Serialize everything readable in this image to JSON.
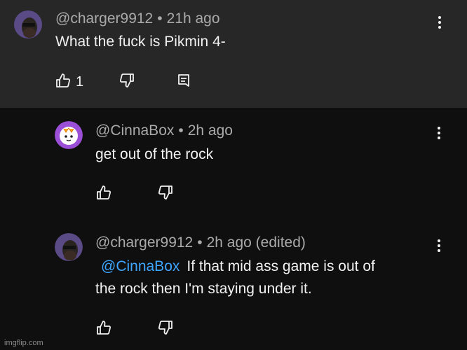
{
  "comments": [
    {
      "handle": "@charger9912",
      "time": "21h ago",
      "text": "What the fuck is Pikmin 4-",
      "like_count": "1"
    },
    {
      "handle": "@CinnaBox",
      "time": "2h ago",
      "text": "get out of the rock"
    },
    {
      "handle": "@charger9912",
      "time": "2h ago (edited)",
      "mention": "@CinnaBox",
      "text_line1": "If that mid ass game is out of",
      "text_line2": "the rock then I'm staying under it."
    }
  ],
  "header_separator": "•",
  "watermark": "imgflip.com",
  "colors": {
    "background": "#0f0f0f",
    "highlight": "#272727",
    "mention": "#3ea6ff",
    "meta_text": "#aaaaaa"
  }
}
